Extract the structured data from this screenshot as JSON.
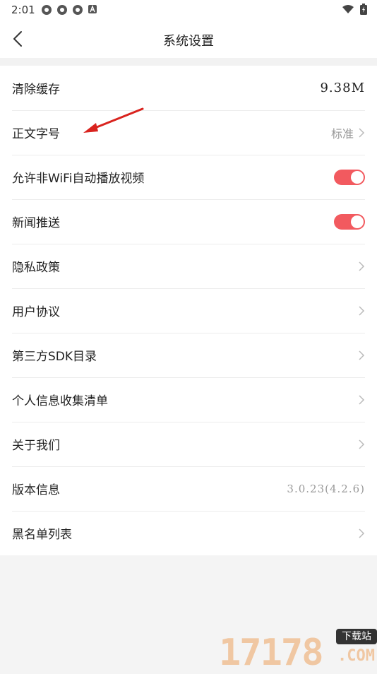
{
  "status_bar": {
    "time": "2:01",
    "left_icons": [
      "notification-icon",
      "notification-icon",
      "notification-icon",
      "a-badge-icon"
    ],
    "right_icons": [
      "wifi-icon",
      "battery-icon"
    ]
  },
  "header": {
    "title": "系统设置"
  },
  "settings": {
    "cache": {
      "label": "清除缓存",
      "value": "9.38M"
    },
    "font_size": {
      "label": "正文字号",
      "value": "标准"
    },
    "autoplay": {
      "label": "允许非WiFi自动播放视频",
      "enabled": true
    },
    "push": {
      "label": "新闻推送",
      "enabled": true
    },
    "privacy": {
      "label": "隐私政策"
    },
    "agreement": {
      "label": "用户协议"
    },
    "sdk": {
      "label": "第三方SDK目录"
    },
    "info_list": {
      "label": "个人信息收集清单"
    },
    "about": {
      "label": "关于我们"
    },
    "version": {
      "label": "版本信息",
      "value": "3.0.23(4.2.6)"
    },
    "blacklist": {
      "label": "黑名单列表"
    }
  },
  "watermark": {
    "digits": "17178",
    "tag": "下载站",
    "suffix": ".COM"
  },
  "colors": {
    "toggle_on": "#f25a5f",
    "annotation_arrow": "#d9231e"
  }
}
